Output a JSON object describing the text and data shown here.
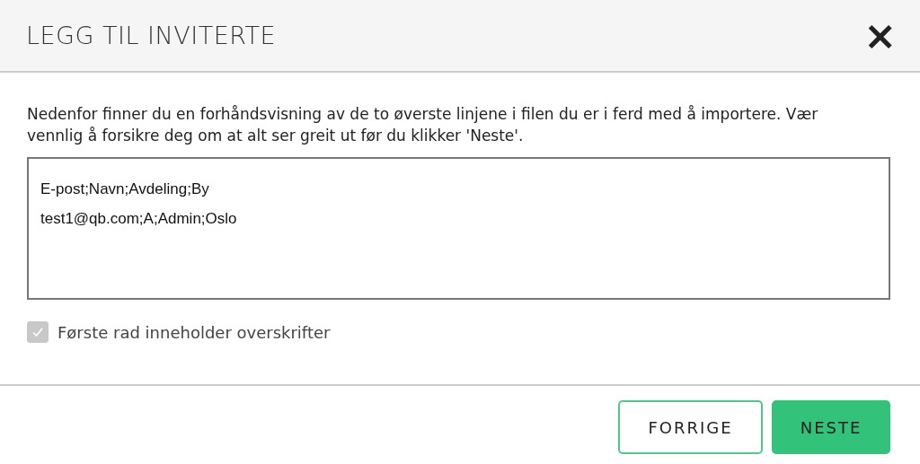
{
  "dialog": {
    "title": "LEGG TIL INVITERTE",
    "close_icon": "×"
  },
  "description": "Nedenfor finner du en forhåndsvisning av de to øverste linjene i filen du er i ferd med å importere. Vær vennlig å forsikre deg om at alt ser greit ut før du klikker 'Neste'.",
  "preview_lines": [
    "E-post;Navn;Avdeling;By",
    "test1@qb.com;A;Admin;Oslo"
  ],
  "header_checkbox": {
    "label": "Første rad inneholder overskrifter",
    "checked": true,
    "disabled": true
  },
  "buttons": [
    {
      "label": "FORRIGE",
      "kind": "secondary"
    },
    {
      "label": "NESTE",
      "kind": "primary"
    }
  ]
}
